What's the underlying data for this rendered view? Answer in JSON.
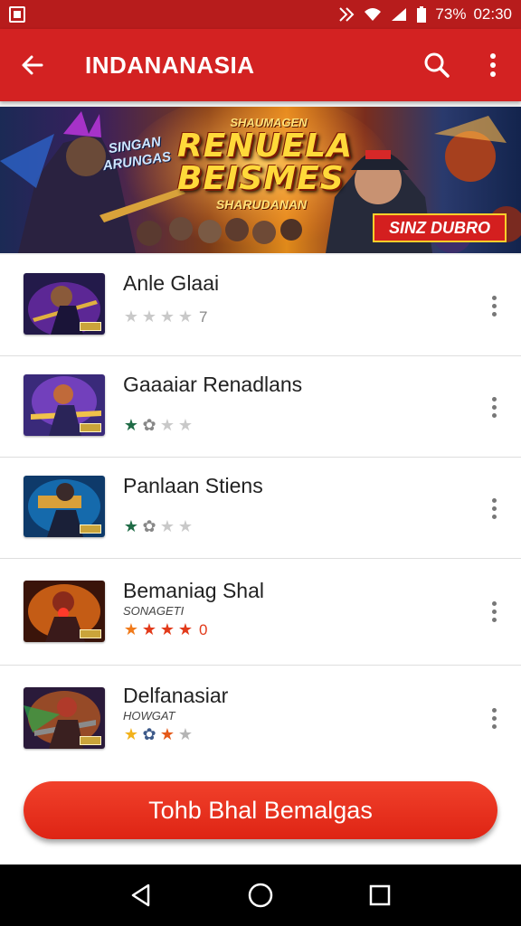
{
  "status_bar": {
    "battery": "73%",
    "time": "02:30"
  },
  "app_bar": {
    "title": "INDANANASIA"
  },
  "banner": {
    "top_text": "SHAUMAGEN",
    "title_line1": "RENUELA",
    "title_line2": "BEISMES",
    "subtitle": "SHARUDANAN",
    "badge_left": "SINGAN ARUNGAS",
    "tag": "SINZ DUBRO"
  },
  "items": [
    {
      "title": "Anle Glaai",
      "subtitle": "",
      "rating_value": "7",
      "stars": [
        {
          "glyph": "★",
          "color": "#c9c9c9"
        },
        {
          "glyph": "★",
          "color": "#c9c9c9"
        },
        {
          "glyph": "★",
          "color": "#c9c9c9"
        },
        {
          "glyph": "★",
          "color": "#c9c9c9"
        }
      ]
    },
    {
      "title": "Gaaaiar Renadlans",
      "subtitle": "",
      "rating_value": "",
      "stars": [
        {
          "glyph": "★",
          "color": "#1f6b46"
        },
        {
          "glyph": "✿",
          "color": "#888888"
        },
        {
          "glyph": "★",
          "color": "#c9c9c9"
        },
        {
          "glyph": "★",
          "color": "#c9c9c9"
        }
      ]
    },
    {
      "title": "Panlaan Stiens",
      "subtitle": "",
      "rating_value": "",
      "stars": [
        {
          "glyph": "★",
          "color": "#1f6b46"
        },
        {
          "glyph": "✿",
          "color": "#888888"
        },
        {
          "glyph": "★",
          "color": "#c9c9c9"
        },
        {
          "glyph": "★",
          "color": "#c9c9c9"
        }
      ]
    },
    {
      "title": "Bemaniag Shal",
      "subtitle": "SONAGETI",
      "rating_value": "0",
      "stars": [
        {
          "glyph": "★",
          "color": "#f07a1a"
        },
        {
          "glyph": "★",
          "color": "#e23a1a"
        },
        {
          "glyph": "★",
          "color": "#e23a1a"
        },
        {
          "glyph": "★",
          "color": "#e23a1a"
        }
      ]
    },
    {
      "title": "Delfanasiar",
      "subtitle": "HOWGAT",
      "rating_value": "",
      "stars": [
        {
          "glyph": "★",
          "color": "#f2b21c"
        },
        {
          "glyph": "✿",
          "color": "#3d5a8a"
        },
        {
          "glyph": "★",
          "color": "#e55a1a"
        },
        {
          "glyph": "★",
          "color": "#b5b5b5"
        }
      ]
    }
  ],
  "cta": {
    "label": "Tohb Bhal Bemalgas"
  },
  "colors": {
    "primary": "#d32222",
    "status_bar": "#b71c1c",
    "cta": "#e52c19"
  }
}
